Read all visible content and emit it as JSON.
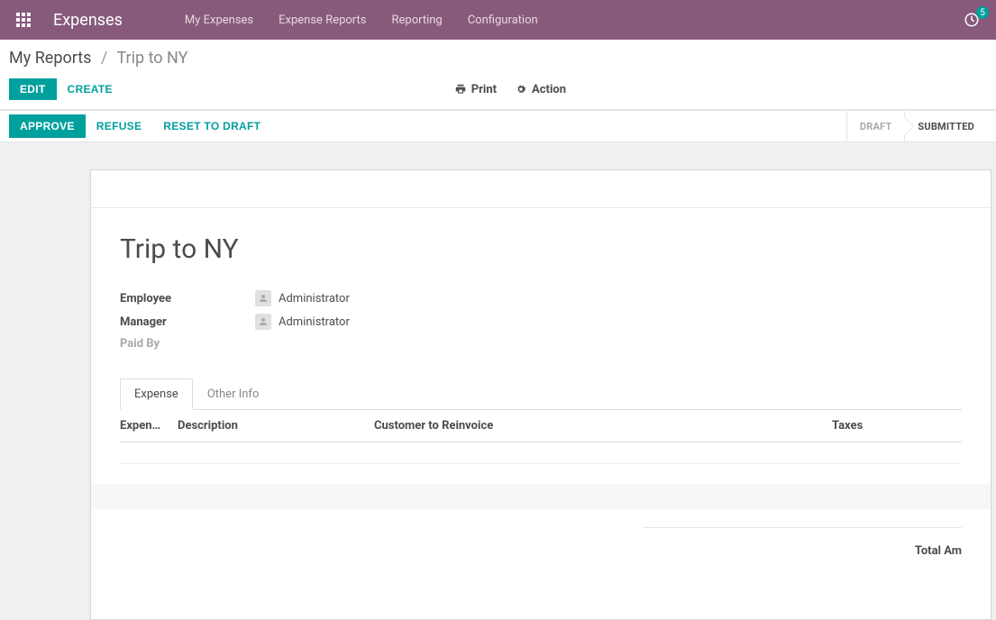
{
  "topbar": {
    "brand": "Expenses",
    "nav": {
      "my_expenses": "My Expenses",
      "expense_reports": "Expense Reports",
      "reporting": "Reporting",
      "configuration": "Configuration"
    },
    "notification_count": "5"
  },
  "breadcrumb": {
    "root": "My Reports",
    "leaf": "Trip to NY"
  },
  "cp": {
    "edit": "EDIT",
    "create": "CREATE",
    "print": "Print",
    "action": "Action"
  },
  "statusbar": {
    "approve": "APPROVE",
    "refuse": "REFUSE",
    "reset": "RESET TO DRAFT",
    "steps": {
      "draft": "DRAFT",
      "submitted": "SUBMITTED"
    }
  },
  "sheet": {
    "title": "Trip to NY",
    "fields": {
      "employee_label": "Employee",
      "employee_value": "Administrator",
      "manager_label": "Manager",
      "manager_value": "Administrator",
      "paidby_label": "Paid By"
    },
    "tabs": {
      "expense": "Expense",
      "other": "Other Info"
    },
    "columns": {
      "a": "Expen…",
      "b": "Description",
      "c": "Customer to Reinvoice",
      "d": "Taxes"
    },
    "total_label": "Total Am"
  }
}
